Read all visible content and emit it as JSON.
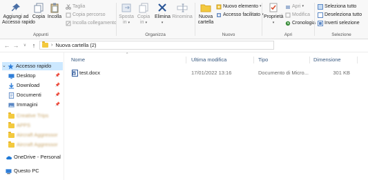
{
  "ribbon": {
    "groups": {
      "clipboard": "Appunti",
      "organize": "Organizza",
      "new": "Nuovo",
      "open": "Apri",
      "select": "Selezione"
    },
    "pin_quick_access": [
      "Aggiungi ad",
      "Accesso rapido"
    ],
    "copy": "Copia",
    "paste": "Incolla",
    "cut": "Taglia",
    "copy_path": "Copia percorso",
    "paste_shortcut": "Incolla collegamento",
    "move_to": [
      "Sposta",
      "in"
    ],
    "copy_to": [
      "Copia",
      "in"
    ],
    "delete": "Elimina",
    "rename": "Rinomina",
    "new_folder": [
      "Nuova",
      "cartella"
    ],
    "new_item": "Nuovo elemento",
    "easy_access": "Accesso facilitato",
    "properties": "Proprietà",
    "open": "Apri",
    "edit": "Modifica",
    "history": "Cronologia",
    "select_all": "Seleziona tutto",
    "select_none": "Deseleziona tutto",
    "invert_selection": "Inverti selezione"
  },
  "address": {
    "path": "Nuova cartella (2)"
  },
  "nav_pane": {
    "quick_access": "Accesso rapido",
    "desktop": "Desktop",
    "downloads": "Download",
    "documents": "Documenti",
    "pictures": "Immagini",
    "blurred_items": [
      "Creative Trips",
      "APPS",
      "Aircraft Aggressor",
      "Aircraft Aggressor"
    ],
    "onedrive": "OneDrive - Personal",
    "this_pc": "Questo PC"
  },
  "file_list": {
    "columns": [
      "Nome",
      "Ultima modifica",
      "Tipo",
      "Dimensione"
    ],
    "rows": [
      {
        "name": "test.docx",
        "modified": "17/01/2022 13:16",
        "type": "Documento di Micro...",
        "size": "301 KB"
      }
    ]
  },
  "colors": {
    "selection": "#cce8ff",
    "header_text": "#3a5a80",
    "folder": "#f3c93e",
    "delete_x": "#2b5797",
    "onedrive": "#1e78d6"
  }
}
